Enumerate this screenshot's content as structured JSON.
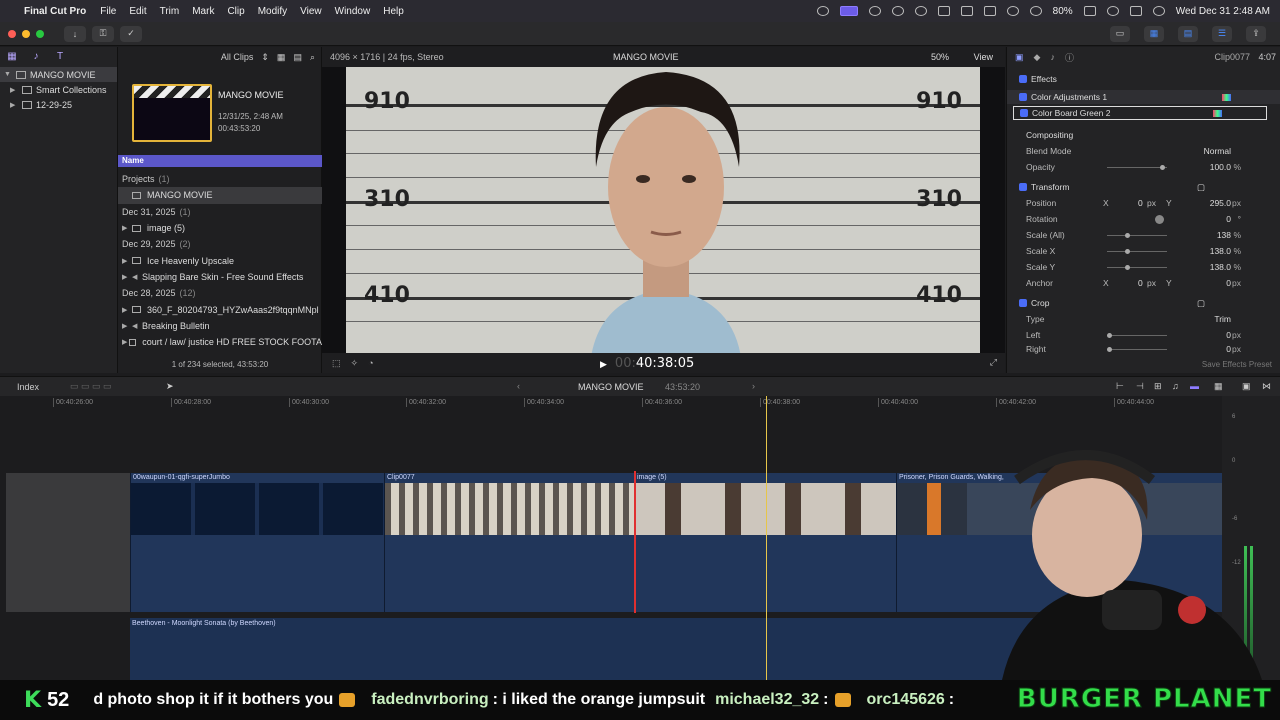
{
  "menubar": {
    "app_name": "Final Cut Pro",
    "menus": [
      "File",
      "Edit",
      "Trim",
      "Mark",
      "Clip",
      "Modify",
      "View",
      "Window",
      "Help"
    ],
    "battery": "80%",
    "datetime": "Wed Dec 31  2:48 AM"
  },
  "libraries": {
    "items": [
      {
        "label": "MANGO MOVIE",
        "selected": true
      },
      {
        "label": "Smart Collections",
        "selected": false
      },
      {
        "label": "12-29-25",
        "selected": false
      }
    ]
  },
  "browser": {
    "filter": "All Clips",
    "project": {
      "name": "MANGO MOVIE",
      "date": "12/31/25, 2:48 AM",
      "duration": "00:43:53:20"
    },
    "column_header": "Name",
    "rows": [
      {
        "type": "group",
        "label": "Projects",
        "count": "(1)"
      },
      {
        "type": "selected",
        "label": "MANGO MOVIE"
      },
      {
        "type": "group",
        "label": "Dec 31, 2025",
        "count": "(1)"
      },
      {
        "type": "item",
        "label": "image (5)"
      },
      {
        "type": "group",
        "label": "Dec 29, 2025",
        "count": "(2)"
      },
      {
        "type": "item",
        "label": "Ice Heavenly Upscale"
      },
      {
        "type": "item",
        "label": "Slapping Bare Skin - Free Sound Effects"
      },
      {
        "type": "group",
        "label": "Dec 28, 2025",
        "count": "(12)"
      },
      {
        "type": "item",
        "label": "360_F_80204793_HYZwAaas2f9tqqnMNpl"
      },
      {
        "type": "item",
        "label": "Breaking Bulletin"
      },
      {
        "type": "item",
        "label": "court / law/ justice HD FREE STOCK FOOTA"
      }
    ],
    "footer": "1 of 234 selected, 43:53:20"
  },
  "viewer": {
    "format": "4096 × 1716 | 24 fps, Stereo",
    "title": "MANGO MOVIE",
    "zoom": "50%",
    "view_label": "View",
    "timecode_dim": "00:",
    "timecode": "40:38:05",
    "height_marks": [
      "910",
      "310",
      "410"
    ]
  },
  "inspector": {
    "clip_name": "Clip0077",
    "duration": "4:07",
    "effects_header": "Effects",
    "effects": [
      "Color Adjustments 1",
      "Color Board Green 2"
    ],
    "compositing_header": "Compositing",
    "blend_mode_label": "Blend Mode",
    "blend_mode_value": "Normal",
    "opacity_label": "Opacity",
    "opacity_value": "100.0",
    "opacity_unit": "%",
    "transform_header": "Transform",
    "position_label": "Position",
    "position_x": "0",
    "position_y": "295.0",
    "px_unit": "px",
    "rotation_label": "Rotation",
    "rotation_value": "0",
    "rotation_unit": "°",
    "scale_all_label": "Scale (All)",
    "scale_all_value": "138",
    "scale_x_label": "Scale X",
    "scale_x_value": "138.0",
    "scale_y_label": "Scale Y",
    "scale_y_value": "138.0",
    "anchor_label": "Anchor",
    "anchor_x": "0",
    "anchor_y": "0",
    "crop_header": "Crop",
    "crop_type_label": "Type",
    "crop_type_value": "Trim",
    "left_label": "Left",
    "left_value": "0",
    "right_label": "Right",
    "right_value": "0",
    "x_label": "X",
    "y_label": "Y",
    "save_preset": "Save Effects Preset"
  },
  "timeline": {
    "index_label": "Index",
    "project_name": "MANGO MOVIE",
    "project_duration": "43:53:20",
    "ruler": [
      "00:40:26:00",
      "00:40:28:00",
      "00:40:30:00",
      "00:40:32:00",
      "00:40:34:00",
      "00:40:36:00",
      "00:40:38:00",
      "00:40:40:00",
      "00:40:42:00",
      "00:40:44:00"
    ],
    "clips": [
      {
        "label": "00waupun-01-qgfi-superJumbo"
      },
      {
        "label": "Clip0077"
      },
      {
        "label": "image (5)"
      },
      {
        "label": "Prisoner, Prison Guards, Walking,"
      }
    ],
    "audio_label": "Beethoven - Moonlight Sonata (by Beethoven)",
    "meter_labels": [
      "6",
      "0",
      "-6",
      "-12"
    ]
  },
  "ticker": {
    "k_count": "52",
    "message1": "d photo shop it if it bothers you",
    "user2": "fadednvrboring",
    "message2": ": i liked the orange jumpsuit",
    "user3": "michael32_32",
    "sep3": ":",
    "user4": "orc145626",
    "sep4": ":",
    "brand": "BURGER PLANET"
  }
}
